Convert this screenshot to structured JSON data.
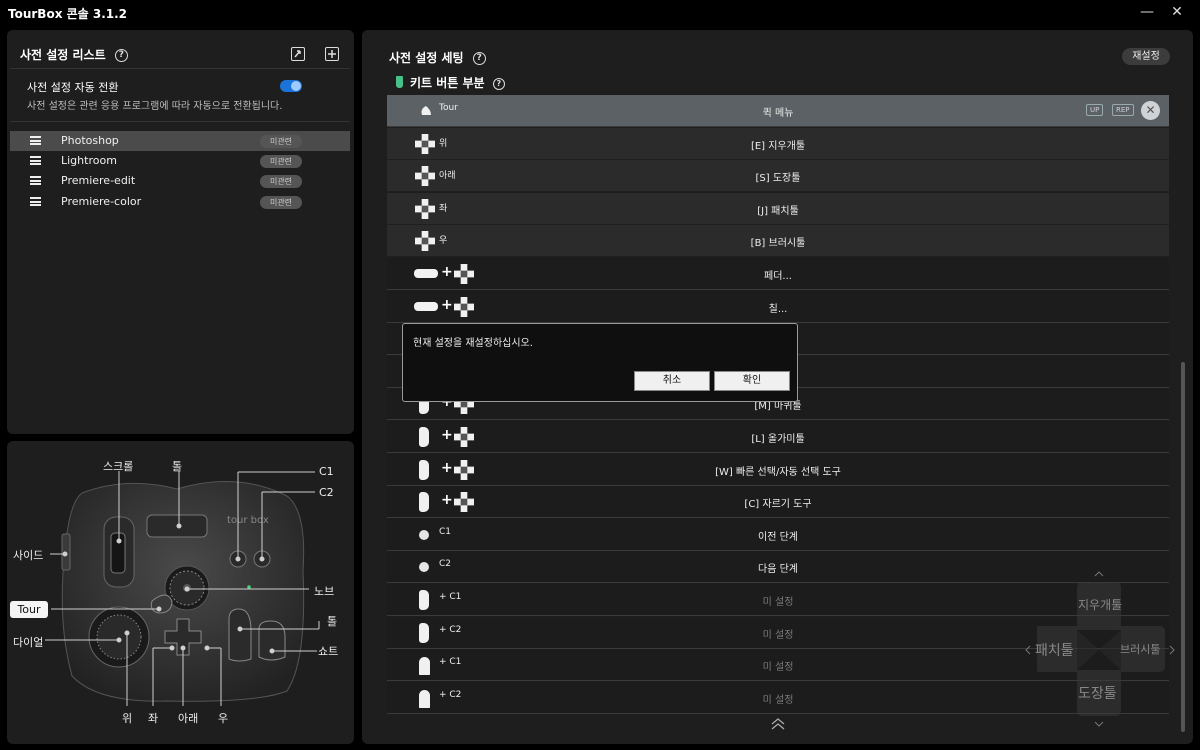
{
  "window": {
    "title": "TourBox 콘솔 3.1.2",
    "minimize": "—",
    "close": "✕"
  },
  "left_panel": {
    "title": "사전 설정 리스트",
    "help": "?",
    "auto_switch_label": "사전 설정 자동 전환",
    "auto_switch_desc": "사전 설정은 관련 응용 프로그램에 따라 자동으로 전환됩니다.",
    "auto_switch_on": true,
    "presets": [
      {
        "name": "Photoshop",
        "tag": "미관련",
        "active": true
      },
      {
        "name": "Lightroom",
        "tag": "미관련",
        "active": false
      },
      {
        "name": "Premiere-edit",
        "tag": "미관련",
        "active": false
      },
      {
        "name": "Premiere-color",
        "tag": "미관련",
        "active": false
      }
    ]
  },
  "device": {
    "labels": {
      "scroll": "스크롤",
      "tall": "톨",
      "c1": "C1",
      "c2": "C2",
      "side": "사이드",
      "knob": "노브",
      "tour": "Tour",
      "dial": "다이얼",
      "short_tall": "톨",
      "short": "쇼트",
      "up": "위",
      "left": "좌",
      "down": "아래",
      "right": "우"
    },
    "logo_text": "tour box"
  },
  "right_panel": {
    "title": "사전 설정 세팅",
    "help": "?",
    "reset_label": "재설정",
    "section_title": "키트 버튼 부분",
    "rows": [
      {
        "name": "Tour",
        "value": "퀵 메뉴",
        "type": "tour",
        "active": true,
        "tags": [
          "UP",
          "REP"
        ]
      },
      {
        "name": "위",
        "value": "[E] 지우개툴",
        "type": "dpad",
        "sub": true
      },
      {
        "name": "아래",
        "value": "[S] 도장툴",
        "type": "dpad",
        "sub": true
      },
      {
        "name": "좌",
        "value": "[J] 패치툴",
        "type": "dpad",
        "sub": true
      },
      {
        "name": "우",
        "value": "[B] 브러시툴",
        "type": "dpad",
        "sub": true
      },
      {
        "name": "",
        "value": "페더...",
        "type": "pill-dpad"
      },
      {
        "name": "",
        "value": "칠...",
        "type": "pill-dpad"
      },
      {
        "name": "",
        "value": "",
        "type": "hidden"
      },
      {
        "name": "",
        "value": "",
        "type": "hidden"
      },
      {
        "name": "",
        "value": "[M] 마퀴툴",
        "type": "side-dpad"
      },
      {
        "name": "",
        "value": "[L] 올가미툴",
        "type": "side-dpad"
      },
      {
        "name": "",
        "value": "[W] 빠른 선택/자동 선택 도구",
        "type": "side-dpad"
      },
      {
        "name": "",
        "value": "[C] 자르기 도구",
        "type": "side-dpad"
      },
      {
        "name": "C1",
        "value": "이전 단계",
        "type": "dot"
      },
      {
        "name": "C2",
        "value": "다음 단계",
        "type": "dot"
      },
      {
        "name": "+ C1",
        "value": "미 설정",
        "type": "side-c",
        "dim": true
      },
      {
        "name": "+ C2",
        "value": "미 설정",
        "type": "side-c",
        "dim": true
      },
      {
        "name": "+ C1",
        "value": "미 설정",
        "type": "knob-c",
        "dim": true
      },
      {
        "name": "+ C2",
        "value": "미 설정",
        "type": "knob-c",
        "dim": true
      }
    ]
  },
  "dialog": {
    "message": "현재 설정을 재설정하십시오.",
    "cancel": "취소",
    "ok": "확인"
  },
  "compass": {
    "up": "지우개툴",
    "left": "패치툴",
    "right": "브러시툴",
    "down": "도장툴"
  }
}
